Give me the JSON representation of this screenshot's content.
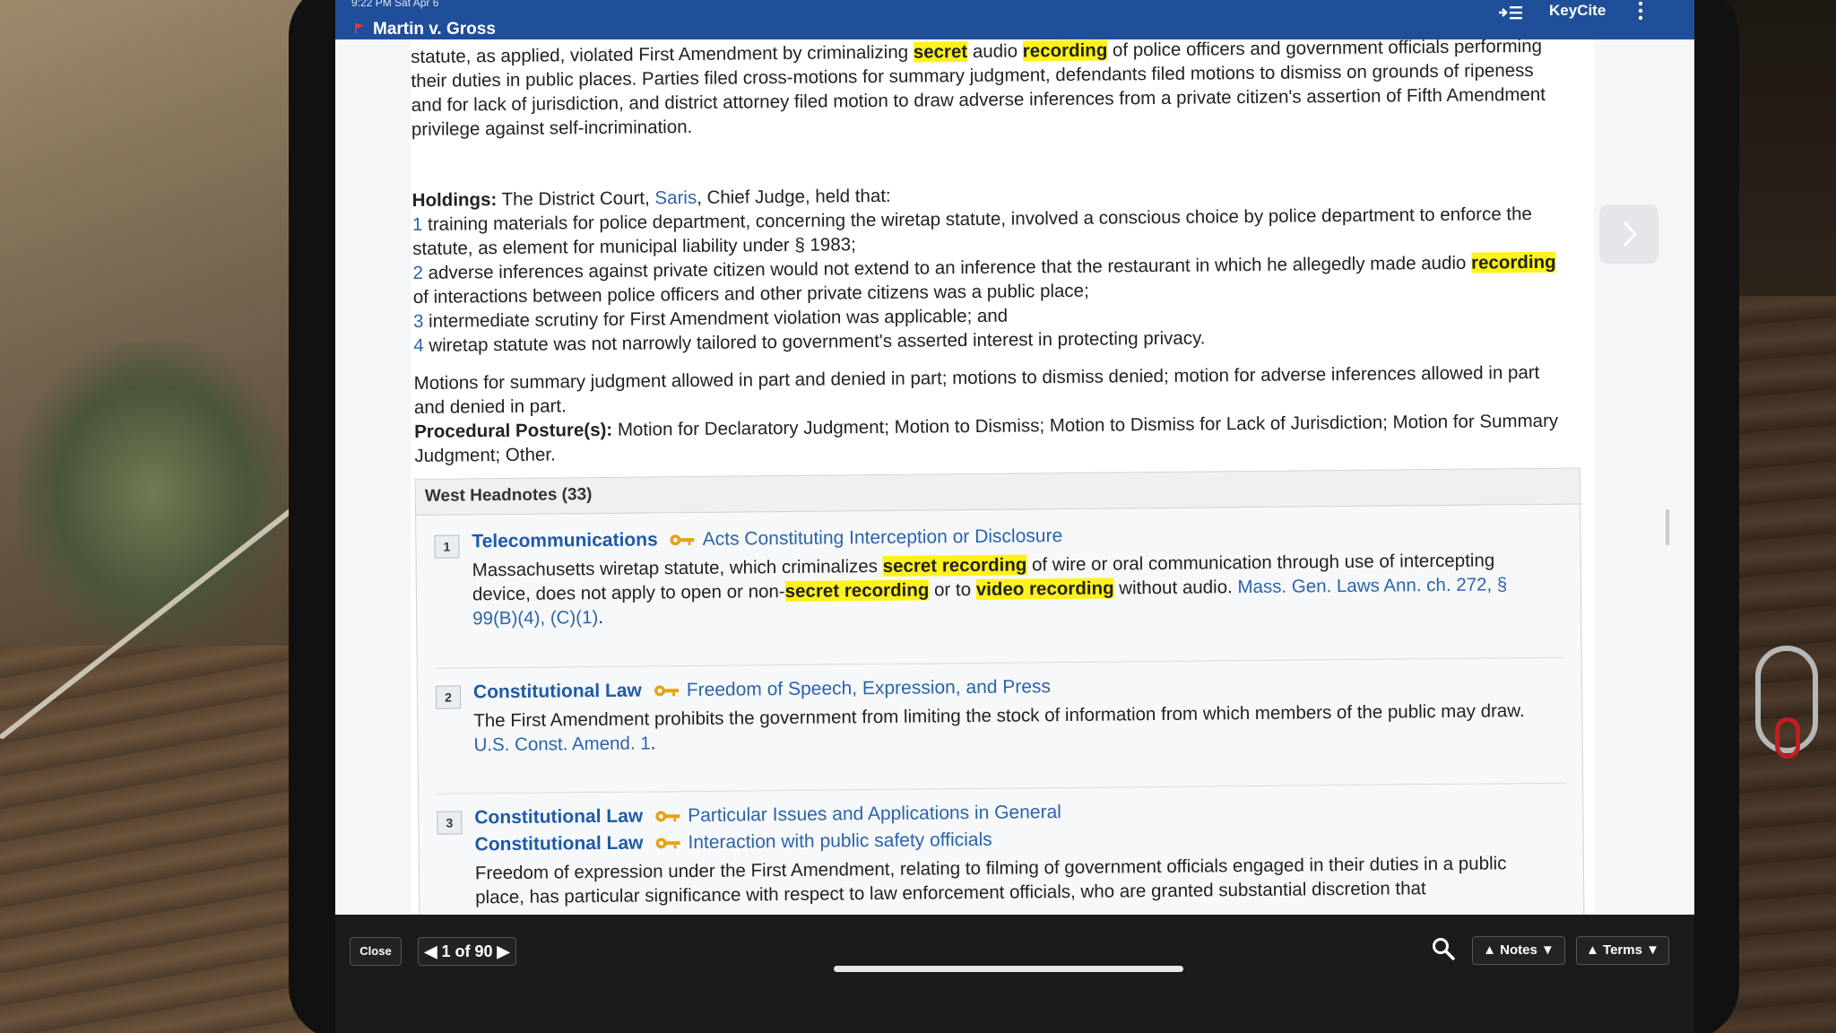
{
  "header": {
    "status_time": "9:22 PM  Sat Apr 6",
    "title": "Martin v. Gross",
    "keycite_label": "KeyCite"
  },
  "summary": {
    "line1_pre": "statute, as applied, violated First Amendment by criminalizing ",
    "line1_hl1": "secret",
    "line1_mid": " audio ",
    "line1_hl2": "recording",
    "line1_post": " of police officers and government officials",
    "rest": "performing their duties in public places. Parties filed cross-motions for summary judgment, defendants filed motions to dismiss on grounds of ripeness and for lack of jurisdiction, and district attorney filed motion to draw adverse inferences from a private citizen's assertion of Fifth Amendment privilege against self-incrimination."
  },
  "holdings": {
    "label": "Holdings:",
    "intro_pre": " The District Court, ",
    "judge_link": "Saris",
    "intro_post": ", Chief Judge, held that:",
    "items": [
      {
        "num": "1",
        "text": " training materials for police department, concerning the wiretap statute, involved a conscious choice by police department to enforce the statute, as element for municipal liability under § 1983;"
      },
      {
        "num": "2",
        "text_pre": " adverse inferences against private citizen would not extend to an inference that the restaurant in which he allegedly made audio ",
        "hl": "recording",
        "text_post": " of interactions between police officers and other private citizens was a public place;"
      },
      {
        "num": "3",
        "text": " intermediate scrutiny for First Amendment violation was applicable; and"
      },
      {
        "num": "4",
        "text": " wiretap statute was not narrowly tailored to government's asserted interest in protecting privacy."
      }
    ]
  },
  "motions": "Motions for summary judgment allowed in part and denied in part; motions to dismiss denied; motion for adverse inferences allowed in part and denied in part.",
  "posture": {
    "label": "Procedural Posture(s):",
    "text": " Motion for Declaratory Judgment; Motion to Dismiss; Motion to Dismiss for Lack of Jurisdiction; Motion for Summary Judgment; Other."
  },
  "headnotes": {
    "title": "West Headnotes (33)",
    "items": [
      {
        "num": "1",
        "topics": [
          {
            "topic": "Telecommunications",
            "sub": "Acts Constituting Interception or Disclosure"
          }
        ],
        "body": {
          "t1": "Massachusetts wiretap statute, which criminalizes ",
          "h1": "secret",
          "s1": " ",
          "h2": "recording",
          "t2": " of wire or oral communication through use of intercepting device, does not apply to open or non-",
          "h3": "secret",
          "s2": " ",
          "h4": "recording",
          "t3": " or to ",
          "h5": "video",
          "s3": " ",
          "h6": "recording",
          "t4": " without audio. ",
          "cite": "Mass. Gen. Laws Ann. ch. 272, § 99(B)(4), (C)(1)",
          "end": "."
        }
      },
      {
        "num": "2",
        "topics": [
          {
            "topic": "Constitutional Law",
            "sub": "Freedom of Speech, Expression, and Press"
          }
        ],
        "body": {
          "t1": "The First Amendment prohibits the government from limiting the stock of information from which members of the public may draw. ",
          "cite": "U.S. Const. Amend. 1",
          "end": "."
        }
      },
      {
        "num": "3",
        "topics": [
          {
            "topic": "Constitutional Law",
            "sub": "Particular Issues and Applications in General"
          },
          {
            "topic": "Constitutional Law",
            "sub": "Interaction with public safety officials"
          }
        ],
        "body": {
          "t1": "Freedom of expression under the First Amendment, relating to filming of government officials engaged in their duties in a public place, has particular significance with respect to law enforcement officials, who are granted substantial discretion that"
        }
      }
    ]
  },
  "footer": {
    "close_label": "Close",
    "pager_label": "1 of 90",
    "notes_label": "Notes",
    "terms_label": "Terms"
  },
  "colors": {
    "header_blue": "#1f4e9a",
    "link_blue": "#2b64ad",
    "highlight_yellow": "#fff21c"
  }
}
